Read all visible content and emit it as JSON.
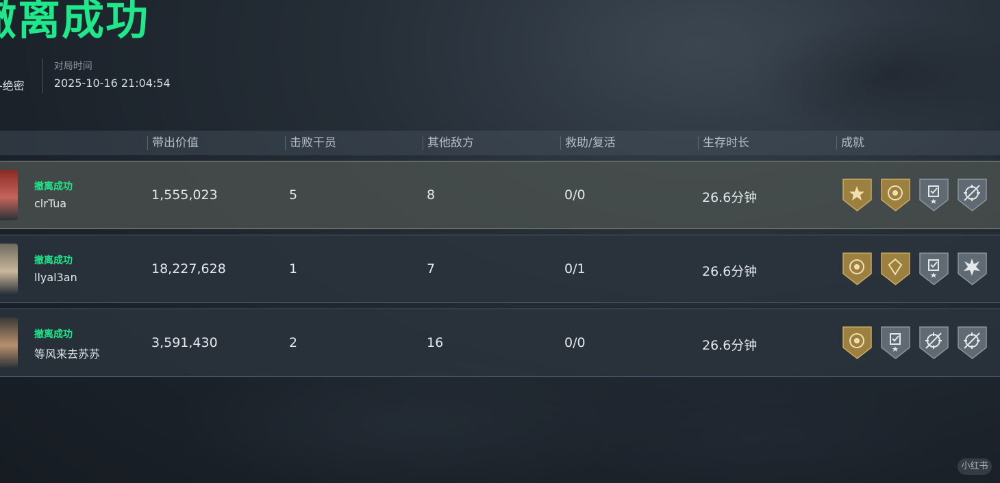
{
  "header": {
    "title": "撤离成功",
    "map_value": "禁地-绝密",
    "time_label": "对局时间",
    "time_value": "2025-10-16 21:04:54"
  },
  "table": {
    "columns": [
      "带出价值",
      "击败干员",
      "其他敌方",
      "救助/复活",
      "生存时长",
      "成就"
    ],
    "rows": [
      {
        "status": "撤离成功",
        "name": "clrTua",
        "value": "1,555,023",
        "kills": "5",
        "other": "8",
        "assist": "0/0",
        "survival": "26.6分钟",
        "badges": [
          "gold-star-badge-icon",
          "gold-emblem-badge-icon",
          "silver-check-badge-icon",
          "silver-crosshair-badge-icon"
        ]
      },
      {
        "status": "撤离成功",
        "name": "llyal3an",
        "value": "18,227,628",
        "kills": "1",
        "other": "7",
        "assist": "0/1",
        "survival": "26.6分钟",
        "badges": [
          "gold-emblem-badge-icon",
          "gold-gem-badge-icon",
          "silver-check-badge-icon",
          "silver-burst-badge-icon"
        ]
      },
      {
        "status": "撤离成功",
        "name": "等风来去苏苏",
        "value": "3,591,430",
        "kills": "2",
        "other": "16",
        "assist": "0/0",
        "survival": "26.6分钟",
        "badges": [
          "gold-emblem-badge-icon",
          "silver-check-badge-icon",
          "silver-crosshair-badge-icon",
          "silver-crosshair-badge-icon"
        ]
      }
    ]
  },
  "watermark": "小红书",
  "colors": {
    "accent": "#1ee88a",
    "gold": "#a8894a",
    "silver": "#6c7780"
  }
}
